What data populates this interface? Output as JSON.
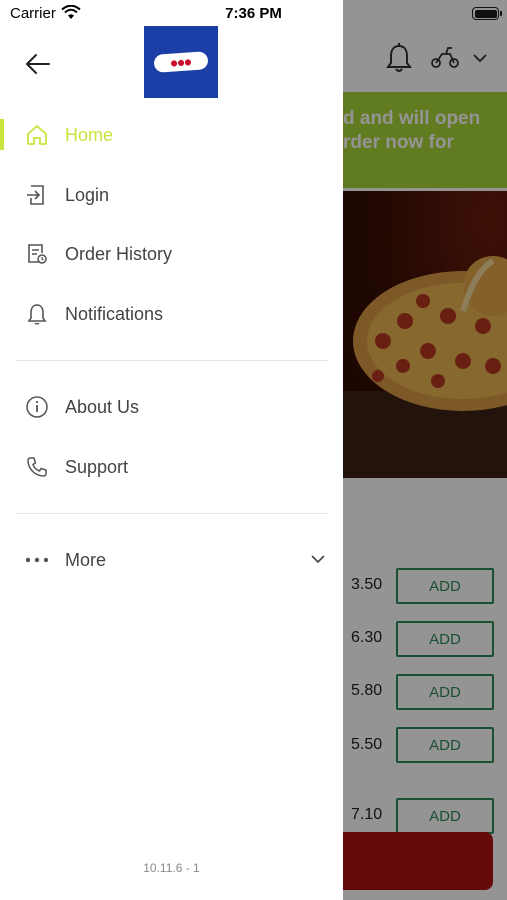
{
  "status_bar": {
    "carrier": "Carrier",
    "time": "7:36 PM"
  },
  "drawer": {
    "menu": [
      {
        "label": "Home",
        "icon": "home-icon",
        "active": true
      },
      {
        "label": "Login",
        "icon": "login-icon"
      },
      {
        "label": "Order History",
        "icon": "order-history-icon"
      },
      {
        "label": "Notifications",
        "icon": "bell-icon"
      },
      {
        "label": "About Us",
        "icon": "info-icon"
      },
      {
        "label": "Support",
        "icon": "phone-icon"
      },
      {
        "label": "More",
        "icon": "more-dots-icon"
      }
    ],
    "version": "10.11.6 - 1",
    "accent_color": "#c6e63c"
  },
  "background": {
    "banner_line1": "d and will open",
    "banner_line2": "rder now for",
    "banner_color": "#a8d43a",
    "items": [
      {
        "price": "3.50",
        "add_label": "ADD"
      },
      {
        "price": "6.30",
        "add_label": "ADD"
      },
      {
        "price": "5.80",
        "add_label": "ADD"
      },
      {
        "price": "5.50",
        "add_label": "ADD"
      },
      {
        "price": "7.10",
        "add_label": "ADD"
      }
    ]
  }
}
